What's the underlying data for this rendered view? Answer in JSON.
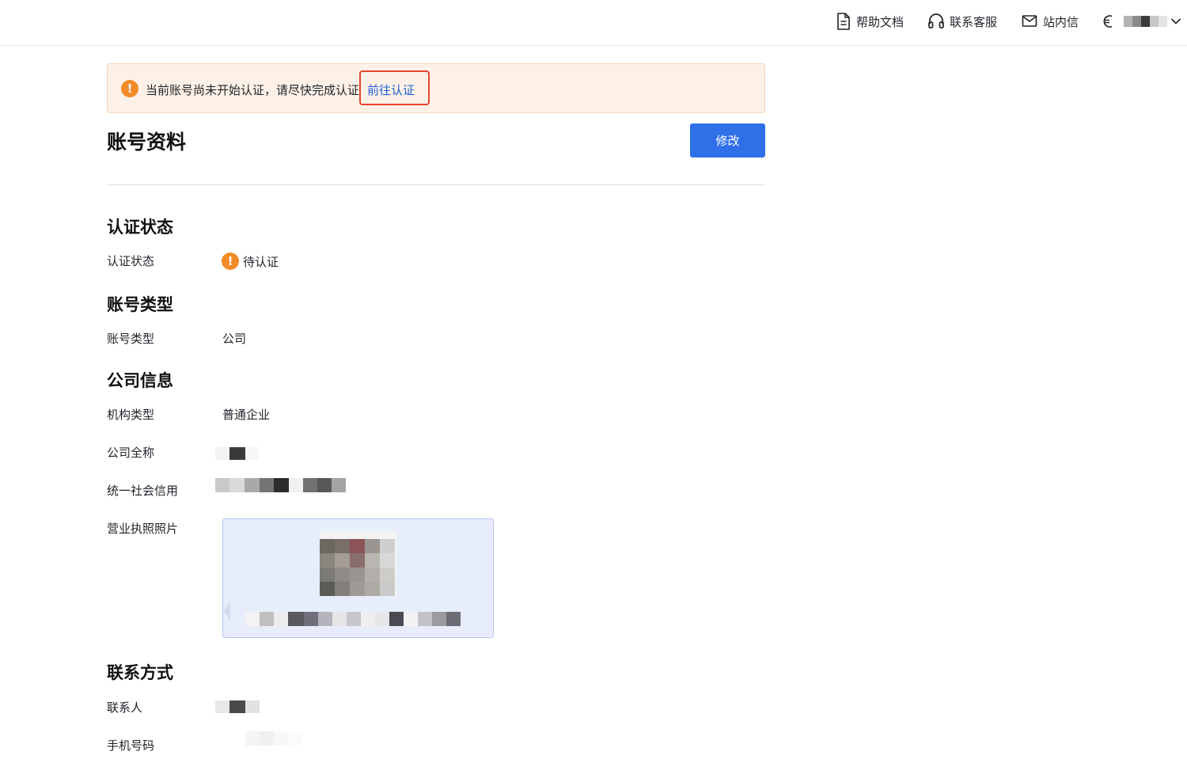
{
  "header": {
    "help_docs": "帮助文档",
    "contact_service": "联系客服",
    "inbox": "站内信"
  },
  "notice": {
    "text": "当前账号尚未开始认证，请尽快完成认证",
    "link": "前往认证"
  },
  "page": {
    "title": "账号资料",
    "edit_button": "修改"
  },
  "sections": {
    "auth": {
      "title": "认证状态",
      "label": "认证状态",
      "value": "待认证"
    },
    "account_type": {
      "title": "账号类型",
      "label": "账号类型",
      "value": "公司"
    },
    "company": {
      "title": "公司信息",
      "org_type_label": "机构类型",
      "org_type_value": "普通企业",
      "full_name_label": "公司全称",
      "credit_code_label": "统一社会信用",
      "license_label": "营业执照照片"
    },
    "contact": {
      "title": "联系方式",
      "contact_person_label": "联系人",
      "phone_label": "手机号码"
    }
  },
  "colors": {
    "primary": "#2f6fe8",
    "link": "#1f5fd6",
    "warning": "#f28c28",
    "notice_bg": "#fdf1e7",
    "highlight_box": "#e5432f"
  },
  "icons": {
    "help": "document-icon",
    "service": "headset-icon",
    "inbox": "mail-icon",
    "user": "currency-icon",
    "warning": "exclamation-icon"
  }
}
